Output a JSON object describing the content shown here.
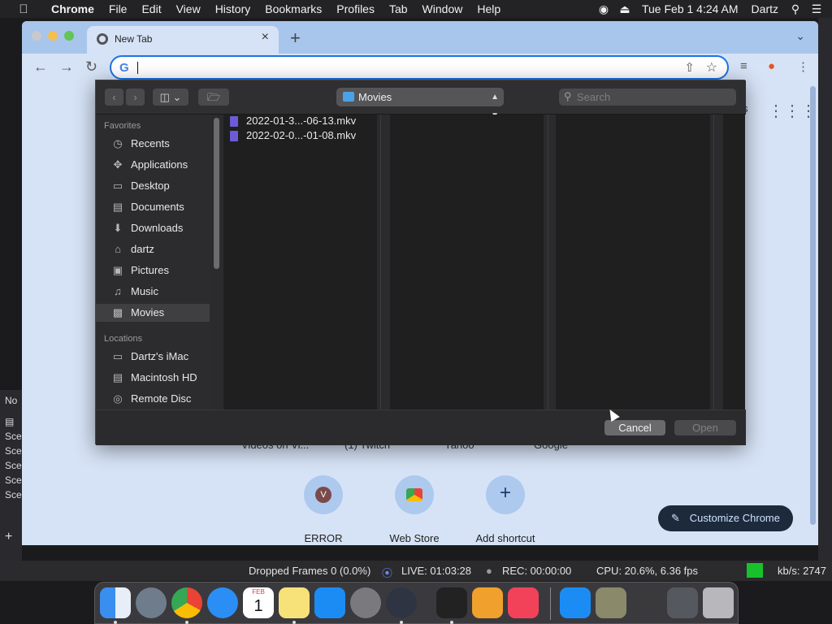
{
  "menubar": {
    "app": "Chrome",
    "items": [
      "File",
      "Edit",
      "View",
      "History",
      "Bookmarks",
      "Profiles",
      "Tab",
      "Window",
      "Help"
    ],
    "datetime": "Tue Feb 1  4:24 AM",
    "user": "Dartz",
    "icons": [
      "apple-icon",
      "obs-status-icon",
      "eject-icon",
      "search-icon",
      "control-center-icon"
    ]
  },
  "obs": {
    "side_rows": [
      "No",
      "Sce",
      "Sce",
      "Sce",
      "Sce",
      "Sce"
    ],
    "status": {
      "dropped_frames": "Dropped Frames 0 (0.0%)",
      "live": "LIVE: 01:03:28",
      "rec": "REC: 00:00:00",
      "cpu": "CPU: 20.6%, 6.36 fps",
      "kbps": "kb/s: 2747"
    },
    "status_color": "#18c12b"
  },
  "chrome": {
    "tab": {
      "title": "New Tab"
    },
    "omnibox": {
      "value": "",
      "placeholder": ""
    },
    "ntp": {
      "hidden_tile_labels": [
        "Videos on Vi...",
        "(1) Twitch",
        "Yahoo",
        "Google"
      ],
      "shortcuts": [
        {
          "label": "ERROR",
          "letter": "V",
          "icon": "error-letter-v-icon"
        },
        {
          "label": "Web Store",
          "letter": "",
          "icon": "web-store-icon"
        },
        {
          "label": "Add shortcut",
          "letter": "+",
          "icon": "plus-icon"
        }
      ],
      "customize_label": "Customize Chrome",
      "partial_text": "s"
    }
  },
  "dialog": {
    "location": "Movies",
    "search_placeholder": "Search",
    "sidebar": {
      "favorites_header": "Favorites",
      "favorites": [
        {
          "label": "Recents",
          "icon": "clock-icon"
        },
        {
          "label": "Applications",
          "icon": "applications-icon"
        },
        {
          "label": "Desktop",
          "icon": "desktop-icon"
        },
        {
          "label": "Documents",
          "icon": "document-icon"
        },
        {
          "label": "Downloads",
          "icon": "download-icon"
        },
        {
          "label": "dartz",
          "icon": "home-icon"
        },
        {
          "label": "Pictures",
          "icon": "camera-icon"
        },
        {
          "label": "Music",
          "icon": "music-note-icon"
        },
        {
          "label": "Movies",
          "icon": "film-icon",
          "selected": true
        }
      ],
      "locations_header": "Locations",
      "locations": [
        {
          "label": "Dartz's iMac",
          "icon": "imac-icon"
        },
        {
          "label": "Macintosh HD",
          "icon": "hard-drive-icon"
        },
        {
          "label": "Remote Disc",
          "icon": "disc-icon"
        }
      ]
    },
    "files": [
      {
        "name": "2022-01-3...-06-13.mkv",
        "icon": "video-file-icon"
      },
      {
        "name": "2022-02-0...-01-08.mkv",
        "icon": "video-file-icon"
      }
    ],
    "cancel_label": "Cancel",
    "open_label": "Open"
  },
  "dock": {
    "apps": [
      "finder-icon",
      "launchpad-icon",
      "chrome-icon",
      "safari-icon",
      "calendar-icon",
      "notes-icon",
      "app-store-icon",
      "system-preferences-icon",
      "obs-icon",
      "video-app-icon",
      "home-app-icon",
      "news-icon",
      "app-store-downloads-icon",
      "photos-stack-icon",
      "folder-stack-icon",
      "screenshot-stack-icon",
      "trash-icon"
    ],
    "calendar": {
      "month": "FEB",
      "day": "1"
    }
  }
}
